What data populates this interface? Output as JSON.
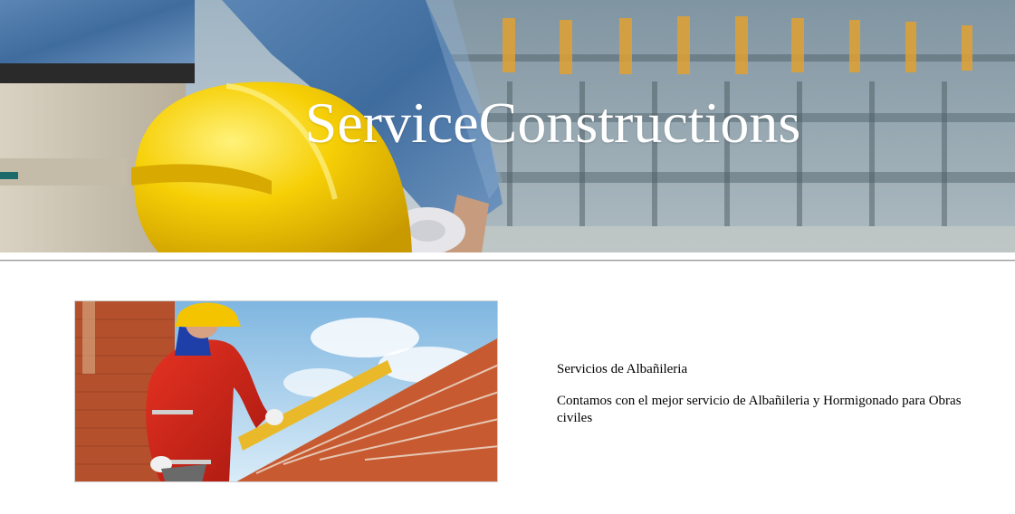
{
  "header": {
    "title": "ServiceConstructions",
    "banner_image": "worker-with-yellow-hard-hat-at-construction-site"
  },
  "service": {
    "image": "bricklayer-laying-bricks",
    "title": "Servicios de Albañileria",
    "description": "Contamos con el mejor servicio de Albañileria y Hormigonado para Obras civiles"
  },
  "colors": {
    "title_text": "#ffffff",
    "helmet_yellow": "#f4c800",
    "brick": "#c8552e",
    "worker_red": "#d42a1e",
    "divider": "#9a9a9a"
  }
}
